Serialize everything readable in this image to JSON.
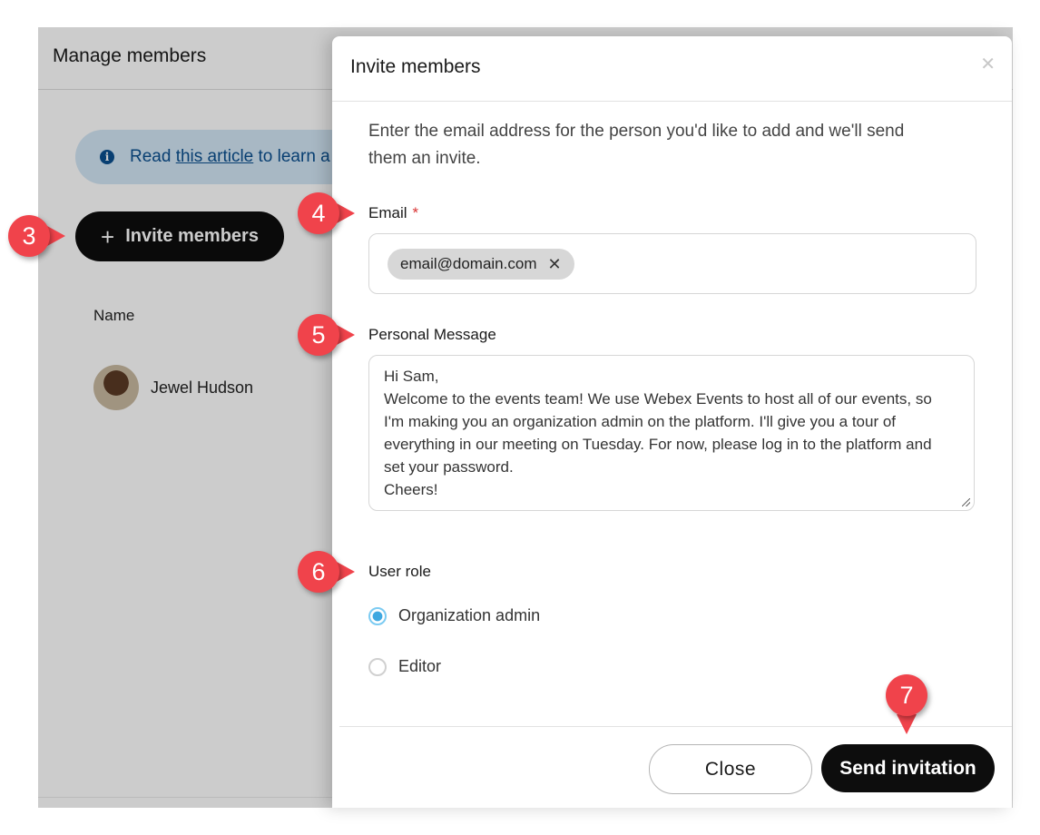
{
  "background": {
    "title": "Manage members",
    "info_banner": {
      "prefix": "Read ",
      "link": "this article",
      "suffix": " to learn a"
    },
    "invite_button": {
      "icon": "plus-icon",
      "label": "Invite members"
    },
    "table": {
      "column_name": "Name",
      "rows": [
        {
          "name": "Jewel Hudson",
          "avatar": "avatar-photo"
        }
      ]
    }
  },
  "modal": {
    "title": "Invite members",
    "close_icon": "close-icon",
    "intro_line1": "Enter the email address for the person you'd like to add and we'll send",
    "intro_line2": "them an invite.",
    "email": {
      "label": "Email",
      "required_marker": "*",
      "chips": [
        {
          "value": "email@domain.com",
          "remove_icon": "close-icon"
        }
      ]
    },
    "personal_message": {
      "label": "Personal Message",
      "lines": [
        "Hi Sam,",
        "Welcome to the events team! We use Webex Events to host all of our events, so",
        "I'm making you an organization admin on the platform. I'll give you a tour of",
        "everything in our meeting on Tuesday. For now, please log in to the platform and",
        "set your password.",
        "Cheers!"
      ]
    },
    "user_role": {
      "label": "User role",
      "options": [
        {
          "label": "Organization admin",
          "selected": true
        },
        {
          "label": "Editor",
          "selected": false
        }
      ]
    },
    "footer": {
      "close_label": "Close",
      "send_label": "Send invitation"
    }
  },
  "callouts": [
    "3",
    "4",
    "5",
    "6",
    "7"
  ],
  "colors": {
    "callout": "#f0434b",
    "primary_button": "#0d0d0d",
    "radio_selected": "#3fa8e0",
    "info_banner": "#d3e6f5"
  }
}
